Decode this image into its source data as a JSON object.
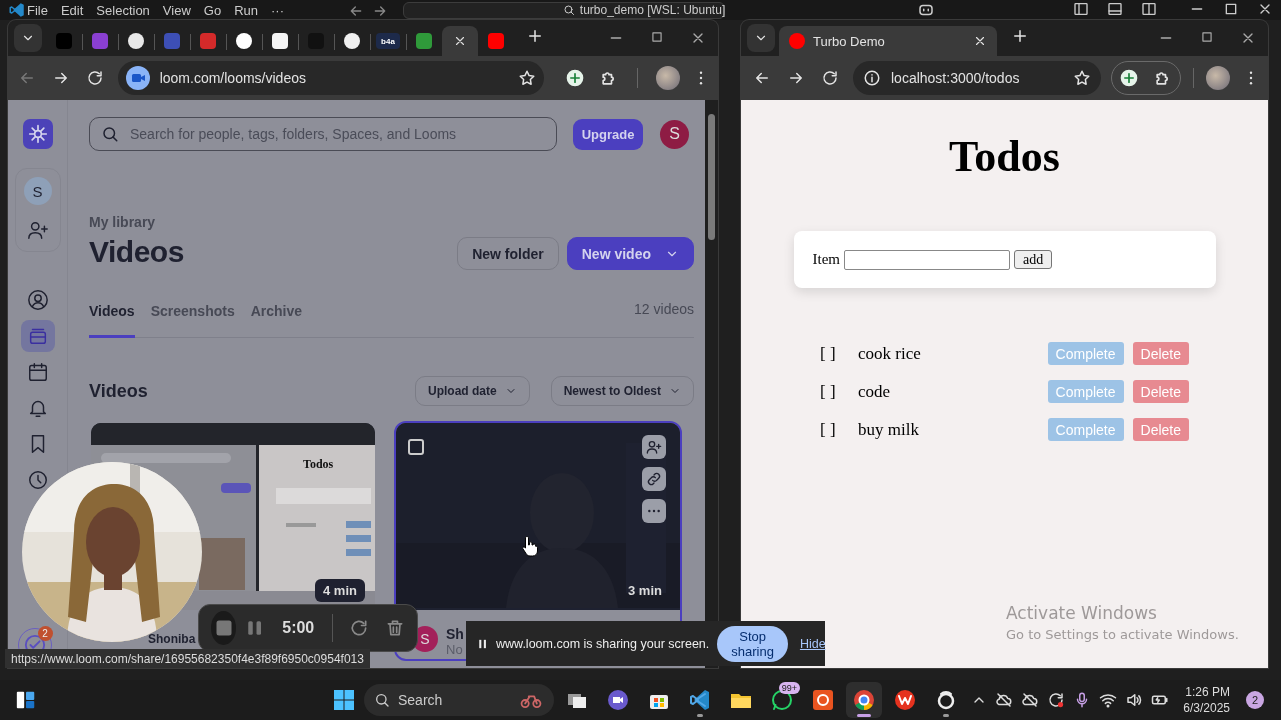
{
  "vscode": {
    "menu": [
      "File",
      "Edit",
      "Selection",
      "View",
      "Go",
      "Run",
      "···"
    ],
    "title": "turbo_demo [WSL: Ubuntu]"
  },
  "left_browser": {
    "tabs": [
      {
        "color": "#000000",
        "selected": false
      },
      {
        "color": "#8a3fd1",
        "selected": false
      },
      {
        "color": "#e8e8e8",
        "selected": false
      },
      {
        "color": "#3d4fb5",
        "selected": false
      },
      {
        "color": "#d42a2a",
        "selected": false
      },
      {
        "color": "#ffffff",
        "selected": false
      },
      {
        "color": "#f5f5f5",
        "selected": false
      },
      {
        "color": "#111111",
        "selected": false
      },
      {
        "color": "#f0f0f0",
        "selected": false
      },
      {
        "color": "#1d2a4a",
        "label": "b4a",
        "selected": false
      },
      {
        "color": "#2f9a3a",
        "selected": false
      },
      {
        "selected": true
      },
      {
        "color": "#ff0000",
        "selected": false
      }
    ],
    "url": "loom.com/looms/videos"
  },
  "loom": {
    "search": {
      "placeholder": "Search for people, tags, folders, Spaces, and Looms"
    },
    "upgrade": "Upgrade",
    "avatar": "S",
    "workspace_avatar": "S",
    "nav": [
      {
        "kind": "profile",
        "selected": false
      },
      {
        "kind": "library",
        "selected": true
      },
      {
        "kind": "calendar",
        "selected": false
      },
      {
        "kind": "bell",
        "selected": false
      },
      {
        "kind": "bookmark",
        "selected": false
      },
      {
        "kind": "clock",
        "selected": false
      }
    ],
    "tasks_badge": "2",
    "breadcrumb": "My library",
    "heading": "Videos",
    "new_folder": "New folder",
    "new_video": "New video",
    "tabs": [
      {
        "label": "Videos",
        "selected": true
      },
      {
        "label": "Screenshots",
        "selected": false
      },
      {
        "label": "Archive",
        "selected": false
      }
    ],
    "count": "12 videos",
    "section": "Videos",
    "sorts": [
      "Upload date",
      "Newest to Oldest"
    ],
    "videos": [
      {
        "kind": "screenshot",
        "thumbnail_title": "Todos",
        "duration": "4 min",
        "title": "Shoniba",
        "hovered": false
      },
      {
        "kind": "camera",
        "duration": "3 min",
        "initial": "S",
        "title": "Sh",
        "subtitle": "No",
        "hovered": true,
        "select_box": {
          "checked": false
        }
      }
    ]
  },
  "todo_browser": {
    "tab": "Turbo Demo",
    "url": "localhost:3000/todos",
    "page": {
      "title": "Todos",
      "field_label": "Item",
      "add": "add",
      "items": [
        {
          "mark": "[ ]",
          "text": "cook rice",
          "complete": "Complete",
          "delete": "Delete"
        },
        {
          "mark": "[ ]",
          "text": "code",
          "complete": "Complete",
          "delete": "Delete"
        },
        {
          "mark": "[ ]",
          "text": "buy milk",
          "complete": "Complete",
          "delete": "Delete"
        }
      ]
    }
  },
  "recorder": {
    "time": "5:00"
  },
  "share_bar": {
    "message": "www.loom.com is sharing your screen.",
    "stop": "Stop sharing",
    "hide": "Hide"
  },
  "link_preview": "https://www.loom.com/share/16955682350f4e3f89f6950c0954f013",
  "activation": {
    "title": "Activate Windows",
    "hint": "Go to Settings to activate Windows."
  },
  "taskbar": {
    "search": "Search",
    "apps": [
      {
        "kind": "taskview",
        "running": false,
        "selected": false
      },
      {
        "kind": "meet",
        "running": false,
        "selected": false
      },
      {
        "kind": "store",
        "running": false,
        "selected": false
      },
      {
        "kind": "vscode",
        "running": true,
        "selected": false
      },
      {
        "kind": "files",
        "running": false,
        "selected": false
      },
      {
        "kind": "whatsapp",
        "running": false,
        "selected": false,
        "badge": "99+"
      },
      {
        "kind": "ubuntu",
        "running": false,
        "selected": false
      },
      {
        "kind": "chrome",
        "running": true,
        "selected": true
      },
      {
        "kind": "wps",
        "running": false,
        "selected": false
      },
      {
        "kind": "obs",
        "running": true,
        "selected": false
      }
    ],
    "time": "1:26 PM",
    "date": "6/3/2025",
    "notifications": "2"
  }
}
